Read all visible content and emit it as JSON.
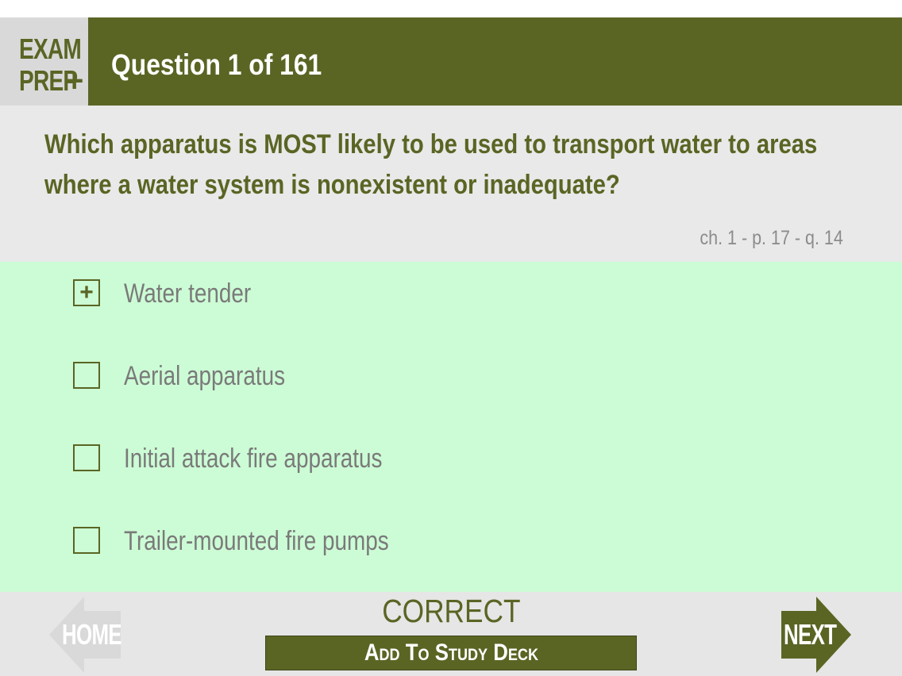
{
  "header": {
    "logo": {
      "line1": "EXAM",
      "line2": "PREP",
      "plus": "+"
    },
    "question_counter": "Question 1 of 161"
  },
  "question": {
    "text": "Which apparatus is MOST likely to be used to transport water to areas where a water system is nonexistent or inadequate?",
    "reference": "ch. 1 - p. 17 - q. 14"
  },
  "answers": [
    {
      "label": "Water tender",
      "selected": true,
      "mark": "+"
    },
    {
      "label": "Aerial apparatus",
      "selected": false,
      "mark": ""
    },
    {
      "label": "Initial attack fire apparatus",
      "selected": false,
      "mark": ""
    },
    {
      "label": "Trailer-mounted fire pumps",
      "selected": false,
      "mark": ""
    }
  ],
  "footer": {
    "home_label": "HOME",
    "next_label": "NEXT",
    "result": "CORRECT",
    "study_deck_label": "Add To Study Deck"
  },
  "colors": {
    "brand_olive": "#5a6524",
    "correct_green": "#ccfcd5",
    "question_bg": "#e9e9e9",
    "footer_bg": "#e6e6e6",
    "home_arrow": "#d9d9d9"
  },
  "icons": {
    "home": "left-arrow-icon",
    "next": "right-arrow-icon",
    "selected_mark": "plus-icon"
  }
}
